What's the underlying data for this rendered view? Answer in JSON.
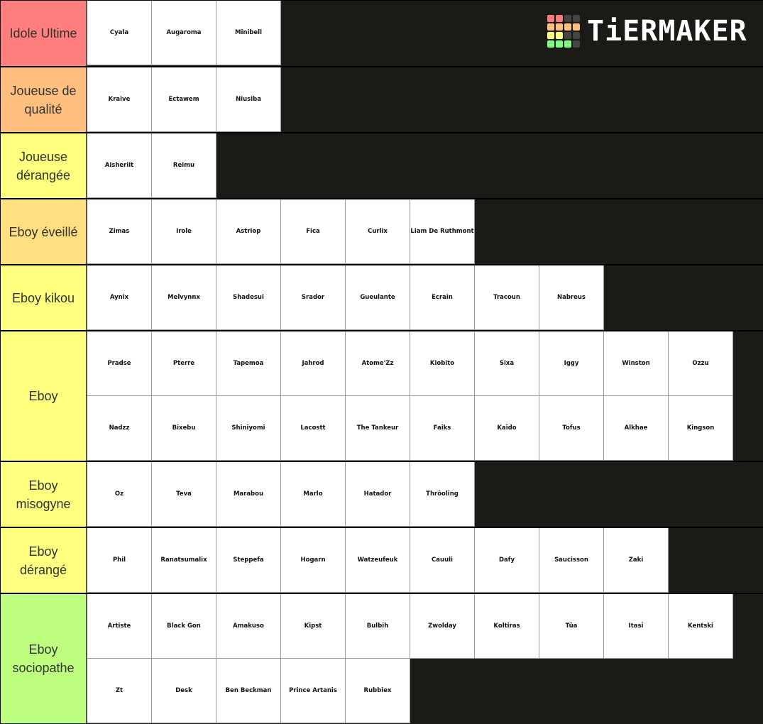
{
  "brand": {
    "name": "TiERMAKER",
    "logo_cells": [
      "#f47c7c",
      "#f47c7c",
      "#444444",
      "#444444",
      "#ffbf7f",
      "#ffbf7f",
      "#ffbf7f",
      "#ffbf7f",
      "#ffff7f",
      "#ffff7f",
      "#444444",
      "#444444",
      "#7fff7f",
      "#7fff7f",
      "#7fff7f",
      "#444444"
    ]
  },
  "tiers": [
    {
      "label": "Idole Ultime",
      "color": "#ff7f7f",
      "items": [
        "Cyala",
        "Augaroma",
        "Minibell"
      ]
    },
    {
      "label": "Joueuse de qualité",
      "color": "#ffbf7f",
      "items": [
        "Kraive",
        "Ectawem",
        "Niusiba"
      ]
    },
    {
      "label": "Joueuse dérangée",
      "color": "#ffff7f",
      "items": [
        "Aisheriit",
        "Reimu"
      ]
    },
    {
      "label": "Eboy éveillé",
      "color": "#ffdf80",
      "items": [
        "Zimas",
        "Irole",
        "Astriop",
        "Fica",
        "Curlix",
        "Liam De Ruthmont"
      ]
    },
    {
      "label": "Eboy  kikou",
      "color": "#ffff7f",
      "items": [
        "Aynix",
        "Melvynnx",
        "Shadesui",
        "Srador",
        "Gueulante",
        "Ecrain",
        "Tracoun",
        "Nabreus"
      ]
    },
    {
      "label": "Eboy",
      "color": "#ffff7f",
      "items": [
        "Pradse",
        "Pterre",
        "Tapemoa",
        "Jahrod",
        "Atome'Zz",
        "Kiobito",
        "Sixa",
        "Iggy",
        "Winston",
        "Ozzu",
        "Nadzz",
        "Bixebu",
        "Shiniyomi",
        "Lacostt",
        "The Tankeur",
        "Faiks",
        "Kaïdo",
        "Tofus",
        "Alkhae",
        "Kingson"
      ]
    },
    {
      "label": "Eboy misogyne",
      "color": "#ffff7f",
      "items": [
        "Oz",
        "Teva",
        "Marabou",
        "Marlo",
        "Hatador",
        "Thrôoling"
      ]
    },
    {
      "label": "Eboy dérangé",
      "color": "#ffff7f",
      "items": [
        "Phil",
        "Ranatsumalix",
        "Steppefa",
        "Hogarn",
        "Watzeufeuk",
        "Cauuli",
        "Dafy",
        "Saucisson",
        "Zaki"
      ]
    },
    {
      "label": "Eboy sociopathe",
      "color": "#bfff7f",
      "items": [
        "Artiste",
        "Black Gon",
        "Amakuso",
        "Kipst",
        "Bulbih",
        "Zwolday",
        "Koltiras",
        "Tüa",
        "Itasi",
        "Kentski",
        "Zt",
        "Desk",
        "Ben Beckman",
        "Prince Artanis",
        "Rubbiex"
      ]
    }
  ]
}
